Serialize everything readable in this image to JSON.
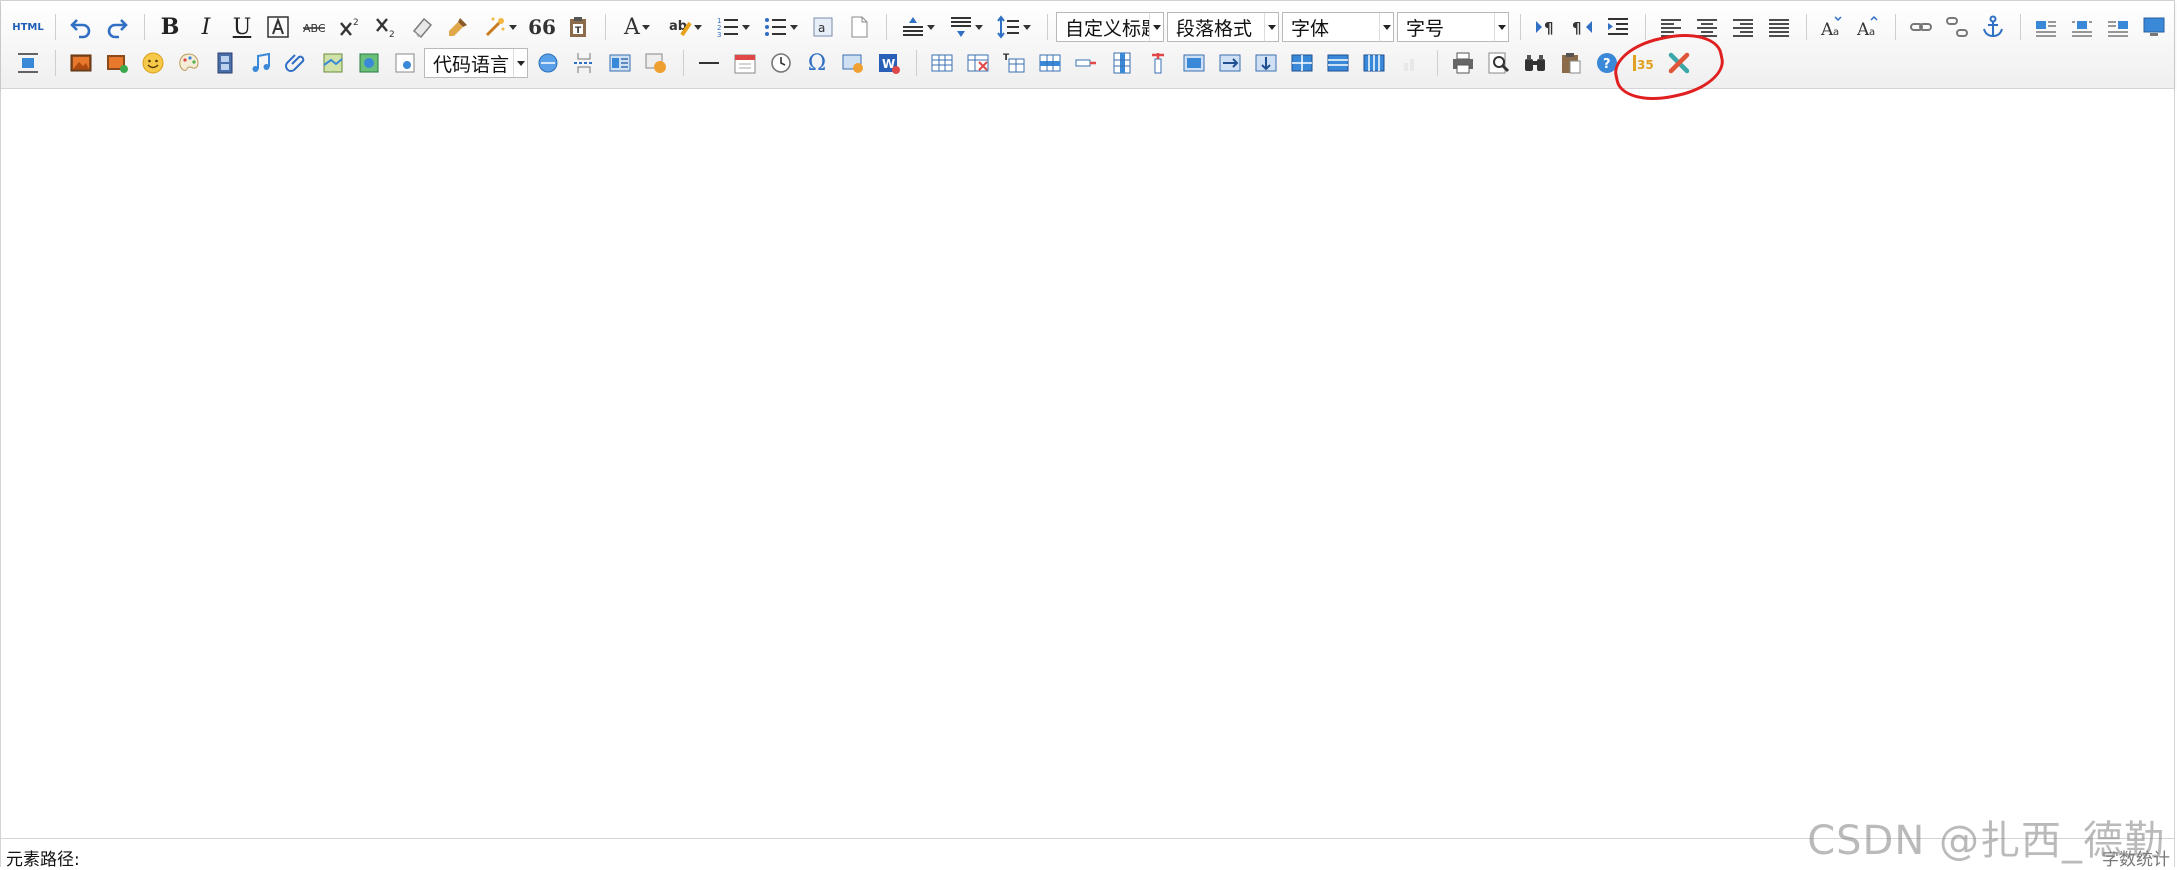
{
  "toolbar": {
    "html_label": "HTML",
    "bold": "B",
    "italic": "I",
    "underline": "U",
    "quote": "66",
    "custom_heading": "自定义标题",
    "paragraph_format": "段落格式",
    "font_family": "字体",
    "font_size": "字号",
    "code_language": "代码语言",
    "accent_color": "#3a7bd5"
  },
  "statusbar": {
    "element_path_label": "元素路径:",
    "word_count_label": "字数统计"
  },
  "watermark": "CSDN @扎西_德勤",
  "annotation": {
    "color": "#e02020"
  }
}
